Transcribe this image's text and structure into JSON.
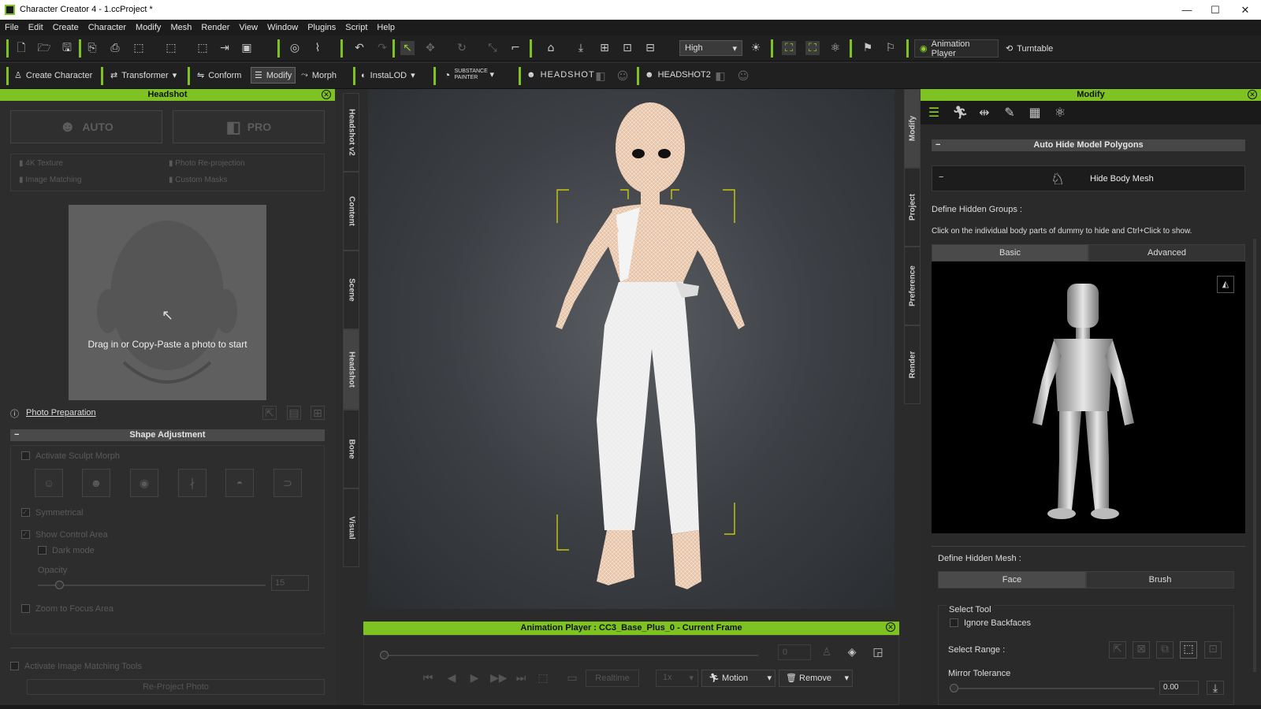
{
  "window": {
    "title": "Character Creator 4 - 1.ccProject *",
    "minimize": "—",
    "maximize": "☐",
    "close": "✕"
  },
  "menu": [
    "File",
    "Edit",
    "Create",
    "Character",
    "Modify",
    "Mesh",
    "Render",
    "View",
    "Window",
    "Plugins",
    "Script",
    "Help"
  ],
  "toolbar1": {
    "quality_select": "High",
    "animation_player_label": "Animation Player",
    "turntable_label": "Turntable"
  },
  "toolbar2": {
    "create_character": "Create Character",
    "transformer": "Transformer",
    "conform": "Conform",
    "modify": "Modify",
    "morph": "Morph",
    "instalod": "InstaLOD",
    "substance_painter": "SUBSTANCE PAINTER",
    "headshot": "HEADSHOT",
    "headshot2": "HEADSHOT2"
  },
  "left_panel": {
    "header": "Headshot",
    "auto_label": "AUTO",
    "pro_label": "PRO",
    "features": [
      "4K Texture",
      "Photo Re-projection",
      "Image Matching",
      "Custom Masks"
    ],
    "drop_text": "Drag in or Copy-Paste a photo to start",
    "photo_prep_link": "Photo Preparation",
    "shape_adjustment": "Shape Adjustment",
    "activate_sculpt": "Activate Sculpt Morph",
    "symmetrical": "Symmetrical",
    "show_control_area": "Show Control Area",
    "dark_mode": "Dark mode",
    "opacity_label": "Opacity",
    "opacity_value": "15",
    "zoom_focus": "Zoom to Focus Area",
    "activate_matching": "Activate Image Matching Tools",
    "reproject_photo": "Re-Project Photo"
  },
  "left_tabs": [
    "Headshot v2",
    "Content",
    "Scene",
    "Headshot",
    "Bone",
    "Visual"
  ],
  "animation_player": {
    "header": "Animation Player : CC3_Base_Plus_0 - Current Frame",
    "frame_value": "0",
    "realtime": "Realtime",
    "speed": "1x",
    "motion": "Motion",
    "remove": "Remove"
  },
  "right_tabs": [
    "Modify",
    "Project",
    "Preference",
    "Render"
  ],
  "right_panel": {
    "header": "Modify",
    "auto_hide_section": "Auto Hide Model Polygons",
    "hide_body_mesh": "Hide Body Mesh",
    "define_hidden_groups": "Define Hidden Groups :",
    "instruction": "Click on the individual body parts of dummy to hide and Ctrl+Click to show.",
    "tab_basic": "Basic",
    "tab_advanced": "Advanced",
    "define_hidden_mesh": "Define Hidden Mesh :",
    "face_btn": "Face",
    "brush_btn": "Brush",
    "select_tool": "Select Tool",
    "ignore_backfaces": "Ignore Backfaces",
    "select_range": "Select Range :",
    "mirror_tolerance": "Mirror Tolerance",
    "mirror_value": "0.00"
  },
  "colors": {
    "accent": "#7ec321",
    "panel": "#2d2d2d"
  }
}
